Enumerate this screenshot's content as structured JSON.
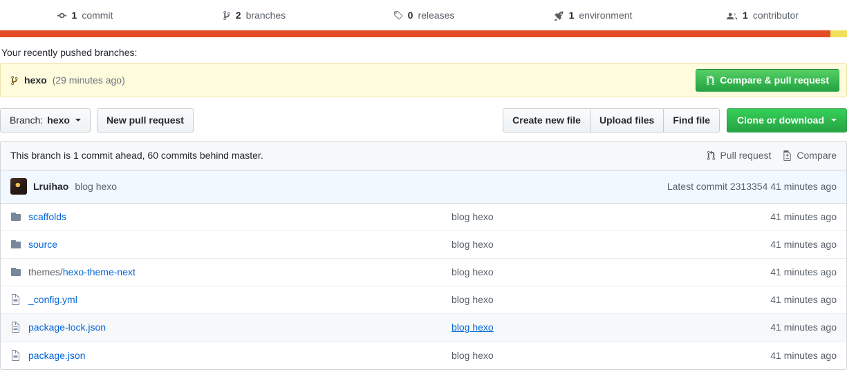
{
  "stats": [
    {
      "icon": "commit-icon",
      "count": "1",
      "label": "commit"
    },
    {
      "icon": "git-branch-icon",
      "count": "2",
      "label": "branches"
    },
    {
      "icon": "tag-icon",
      "count": "0",
      "label": "releases"
    },
    {
      "icon": "rocket-icon",
      "count": "1",
      "label": "environment"
    },
    {
      "icon": "people-icon",
      "count": "1",
      "label": "contributor"
    }
  ],
  "language_bar": [
    {
      "name": "primary",
      "color": "#e34c26",
      "percent": 98
    },
    {
      "name": "secondary",
      "color": "#f1e05a",
      "percent": 2
    }
  ],
  "recently_pushed": {
    "label": "Your recently pushed branches:",
    "branch_icon": "git-branch-icon",
    "branch": "hexo",
    "time": "(29 minutes ago)",
    "button": {
      "icon": "git-pull-request-icon",
      "label": "Compare & pull request",
      "color": "#28a745"
    }
  },
  "toolbar": {
    "branch_prefix": "Branch:",
    "branch_value": "hexo",
    "new_pull_request": "New pull request",
    "create_new_file": "Create new file",
    "upload_files": "Upload files",
    "find_file": "Find file",
    "clone_or_download": "Clone or download"
  },
  "branch_status": {
    "text": "This branch is 1 commit ahead, 60 commits behind master.",
    "pull_request": {
      "icon": "git-pull-request-icon",
      "label": "Pull request"
    },
    "compare": {
      "icon": "diff-icon",
      "label": "Compare"
    }
  },
  "latest_commit": {
    "avatar": "user-avatar",
    "author": "Lruihao",
    "message": "blog hexo",
    "prefix": "Latest commit",
    "sha": "2313354",
    "time": "41 minutes ago"
  },
  "files": [
    {
      "type": "folder",
      "icon": "folder-icon",
      "prefix": "",
      "name": "scaffolds",
      "message": "blog hexo",
      "age": "41 minutes ago",
      "hovered": false
    },
    {
      "type": "folder",
      "icon": "folder-icon",
      "prefix": "",
      "name": "source",
      "message": "blog hexo",
      "age": "41 minutes ago",
      "hovered": false
    },
    {
      "type": "folder",
      "icon": "folder-icon",
      "prefix": "themes/",
      "name": "hexo-theme-next",
      "message": "blog hexo",
      "age": "41 minutes ago",
      "hovered": false
    },
    {
      "type": "file",
      "icon": "file-icon",
      "prefix": "",
      "name": "_config.yml",
      "message": "blog hexo",
      "age": "41 minutes ago",
      "hovered": false
    },
    {
      "type": "file",
      "icon": "file-icon",
      "prefix": "",
      "name": "package-lock.json",
      "message": "blog hexo",
      "age": "41 minutes ago",
      "hovered": true
    },
    {
      "type": "file",
      "icon": "file-icon",
      "prefix": "",
      "name": "package.json",
      "message": "blog hexo",
      "age": "41 minutes ago",
      "hovered": false
    }
  ]
}
